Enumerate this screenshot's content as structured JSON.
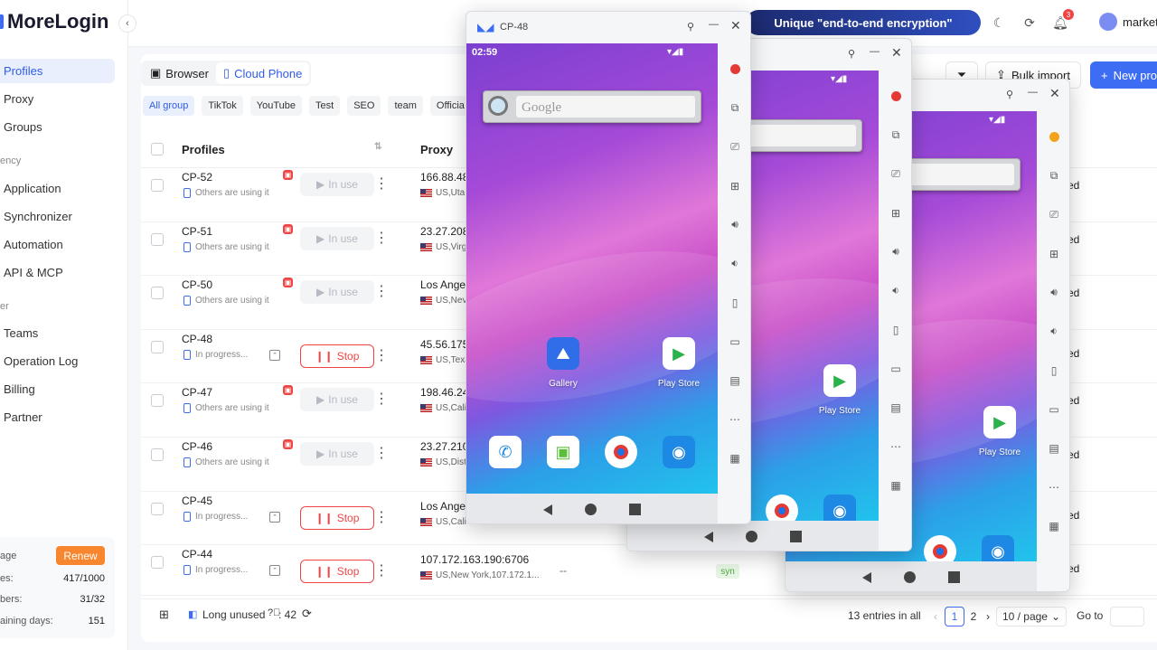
{
  "app": {
    "logo": "MoreLogin"
  },
  "sidebar": {
    "items": [
      {
        "label": "Profiles",
        "active": true
      },
      {
        "label": "Proxy"
      },
      {
        "label": "Groups"
      },
      {
        "label": "Application"
      },
      {
        "label": "Synchronizer"
      },
      {
        "label": "Automation"
      },
      {
        "label": "API & MCP"
      },
      {
        "label": "Teams"
      },
      {
        "label": "Operation Log"
      },
      {
        "label": "Billing"
      },
      {
        "label": "Partner"
      }
    ],
    "sections": {
      "efficiency": "ency",
      "other": "er"
    },
    "footer": {
      "package_label": "age",
      "renew_label": "Renew",
      "profiles_label": "es:",
      "profiles_value": "417/1000",
      "members_label": "bers:",
      "members_value": "31/32",
      "days_label": "aining days:",
      "days_value": "151"
    }
  },
  "topbar": {
    "promo": "Unique \"end-to-end encryption\"",
    "bell_badge": "3",
    "user_name": "marketi"
  },
  "toolbar": {
    "tab_browser": "Browser",
    "tab_cloud_phone": "Cloud Phone",
    "bulk_import": "Bulk import",
    "new_profile": "New pro"
  },
  "groups": [
    "All group",
    "TikTok",
    "YouTube",
    "Test",
    "SEO",
    "team",
    "Officia"
  ],
  "table": {
    "col_profiles": "Profiles",
    "col_proxy": "Proxy",
    "rows": [
      {
        "name": "CP-52",
        "sub": "Others are using it",
        "action": "In use",
        "ip": "166.88.48",
        "loc": "US,Uta",
        "status": "ed"
      },
      {
        "name": "CP-51",
        "sub": "Others are using it",
        "action": "In use",
        "ip": "23.27.208",
        "loc": "US,Virg",
        "status": "ed"
      },
      {
        "name": "CP-50",
        "sub": "Others are using it",
        "action": "In use",
        "ip": "Los Ange",
        "loc": "US,Nev",
        "status": "ed"
      },
      {
        "name": "CP-48",
        "sub": "In progress...",
        "action": "Stop",
        "ip": "45.56.175",
        "loc": "US,Texa",
        "status": "ed"
      },
      {
        "name": "CP-47",
        "sub": "Others are using it",
        "action": "In use",
        "ip": "198.46.24",
        "loc": "US,Cali",
        "status": "ed"
      },
      {
        "name": "CP-46",
        "sub": "Others are using it",
        "action": "In use",
        "ip": "23.27.210",
        "loc": "US,Dist",
        "status": "ed"
      },
      {
        "name": "CP-45",
        "sub": "In progress...",
        "action": "Stop",
        "ip": "Los Ange",
        "loc": "US,Cali",
        "status": "ed"
      },
      {
        "name": "CP-44",
        "sub": "In progress...",
        "action": "Stop",
        "ip": "107.172.163.190:6706",
        "loc": "US,New York,107.172.1...",
        "status": "ed"
      }
    ],
    "dash": "--",
    "tag": "syn"
  },
  "footer": {
    "long_unused_label": "Long unused",
    "long_unused_count": ": 42",
    "entries": "13 entries in all",
    "page1": "1",
    "page2": "2",
    "per_page": "10 / page",
    "goto": "Go to"
  },
  "phones": {
    "front_title": "CP-48",
    "time": "02:59",
    "google": "Google",
    "app_gallery": "Gallery",
    "app_play": "Play Store"
  }
}
